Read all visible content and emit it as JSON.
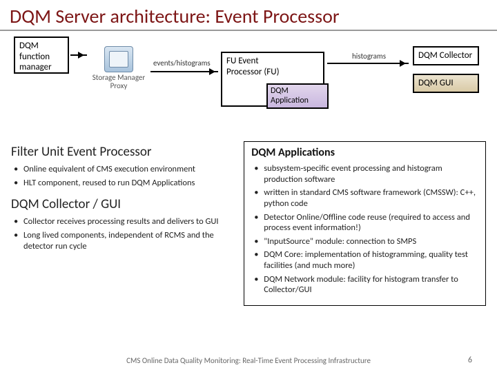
{
  "title": "DQM Server architecture: Event Processor",
  "diagram": {
    "fm": "DQM function manager",
    "smp": "Storage Manager Proxy",
    "label_events": "events/histograms",
    "fu_line1": "FU Event",
    "fu_line2": "Processor (FU)",
    "dqm_app_line1": "DQM",
    "dqm_app_line2": "Application",
    "label_hist": "histograms",
    "collector": "DQM Collector",
    "gui": "DQM GUI"
  },
  "left": {
    "h1": "Filter Unit Event Processor",
    "h1_items": [
      "Online equivalent of CMS execution environment",
      "HLT component, reused to run DQM Applications"
    ],
    "h2": "DQM Collector / GUI",
    "h2_items": [
      "Collector receives processing results and delivers to GUI",
      "Long lived components, independent of RCMS and the detector run cycle"
    ]
  },
  "right": {
    "h": "DQM Applications",
    "items": [
      "subsystem-specific event processing and histogram production software",
      "written in standard CMS software framework (CMSSW): C++, python code",
      "Detector Online/Offline code reuse (required to access and process event information!)",
      "\"InputSource\" module: connection to SMPS",
      "DQM Core: implementation of histogramming, quality test facilities (and much more)",
      "DQM Network module: facility for histogram transfer to Collector/GUI"
    ]
  },
  "footer": "CMS Online Data Quality Monitoring: Real-Time Event Processing Infrastructure",
  "page": "6"
}
